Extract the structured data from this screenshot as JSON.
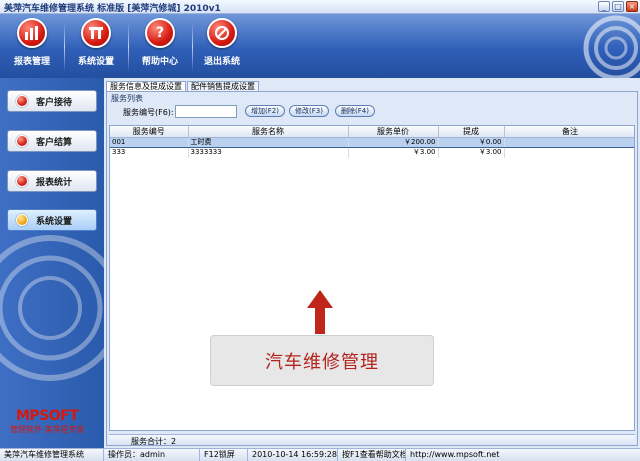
{
  "window": {
    "title": "美萍汽车维修管理系统 标准版 [美萍汽修城]   2010v1",
    "minimize_glyph": "_",
    "maximize_glyph": "□",
    "close_glyph": "×"
  },
  "toolbar": {
    "items": [
      {
        "label": "报表管理",
        "icon": "bar-chart-icon",
        "glyph": "▮▮"
      },
      {
        "label": "系统设置",
        "icon": "tools-icon",
        "glyph": "╥"
      },
      {
        "label": "帮助中心",
        "icon": "help-icon",
        "glyph": "?"
      },
      {
        "label": "退出系统",
        "icon": "exit-icon",
        "glyph": "⊘"
      }
    ]
  },
  "sidebar": {
    "items": [
      {
        "label": "客户接待",
        "active": false
      },
      {
        "label": "客户结算",
        "active": false
      },
      {
        "label": "报表统计",
        "active": false
      },
      {
        "label": "系统设置",
        "active": true
      }
    ],
    "logo": "MPSOFT",
    "slogan": "管理软件  美萍是专家"
  },
  "tabs": [
    {
      "label": "服务信息及提成设置",
      "active": true
    },
    {
      "label": "配件销售提成设置",
      "active": false
    }
  ],
  "panel": {
    "group_title": "服务列表",
    "search_label": "服务编号(F6):",
    "search_value": "",
    "buttons": {
      "add": "增加(F2)",
      "edit": "修改(F3)",
      "delete": "删除(F4)"
    }
  },
  "table": {
    "columns": [
      "服务编号",
      "服务名称",
      "服务单价",
      "提成",
      "备注"
    ],
    "rows": [
      {
        "code": "001",
        "name": "工时费",
        "price": "￥200.00",
        "commission": "￥0.00",
        "note": ""
      },
      {
        "code": "333",
        "name": "3333333",
        "price": "￥3.00",
        "commission": "￥3.00",
        "note": ""
      }
    ],
    "footer_total": "服务合计：2"
  },
  "overlay": {
    "caption": "汽车维修管理"
  },
  "statusbar": {
    "app": "美萍汽车维修管理系统",
    "operator": "操作员：admin",
    "lock": "F12锁屏",
    "datetime": "2010-10-14 16:59:28",
    "help": "按F1查看帮助文档",
    "url": "http://www.mpsoft.net"
  },
  "colors": {
    "banner": "#2f5fb8",
    "accent_red": "#d41a10",
    "selected_row": "#b9d1ee"
  }
}
